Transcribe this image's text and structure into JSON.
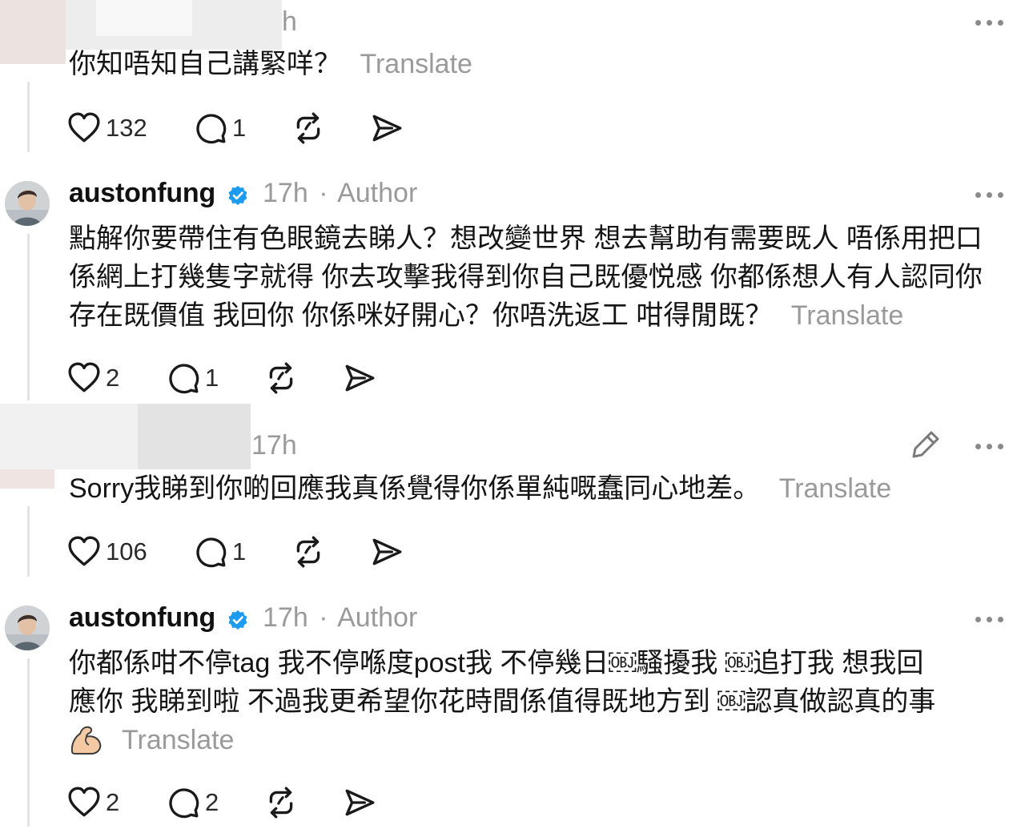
{
  "comments": [
    {
      "username": "",
      "time": "h",
      "text_lines": [
        "你知唔知自己講緊咩？"
      ],
      "translate": "Translate",
      "likes": "132",
      "replies": "1"
    },
    {
      "username": "austonfung",
      "time": "17h",
      "separator": "·",
      "role": "Author",
      "text_lines": [
        "點解你要帶住有色眼鏡去睇人？想改變世界 想去幫助有需要既人 唔係用把口",
        "係網上打幾隻字就得 你去攻擊我得到你自己既優悦感 你都係想人有人認同你",
        "存在既價值 我回你 你係咪好開心？你唔洗返工 咁得閒既？"
      ],
      "translate": "Translate",
      "likes": "2",
      "replies": "1"
    },
    {
      "username": "",
      "time": "17h",
      "text_lines": [
        "Sorry我睇到你啲回應我真係覺得你係單純嘅蠢同心地差。"
      ],
      "translate": "Translate",
      "likes": "106",
      "replies": "1"
    },
    {
      "username": "austonfung",
      "time": "17h",
      "separator": "·",
      "role": "Author",
      "text_lines": [
        "你都係咁不停tag 我不停喺度post我 不停幾日￼騷擾我 ￼追打我 想我回",
        "應你 我睇到啦 不過我更希望你花時間係值得既地方到 ￼認真做認真的事"
      ],
      "emoji": "flexed-biceps-emoji",
      "translate": "Translate",
      "likes": "2",
      "replies": "2"
    }
  ],
  "icons": {
    "like": "heart-icon",
    "reply": "speech-bubble-icon",
    "repost": "repost-icon",
    "share": "send-icon",
    "more": "more-dots-icon",
    "edit": "pencil-icon",
    "verified": "verified-badge-icon"
  },
  "colors": {
    "verified": "#1d9bf0",
    "muted": "#9a9a9a",
    "thread_line": "#e3e3e3"
  }
}
